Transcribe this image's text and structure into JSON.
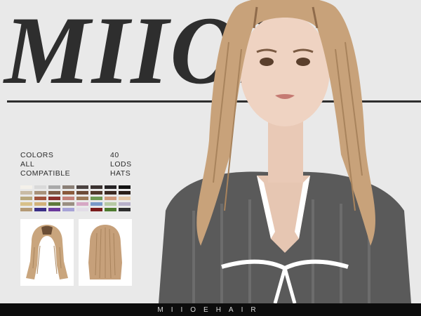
{
  "brand": {
    "title": "MIIOE"
  },
  "info": {
    "col1": [
      "COLORS",
      "ALL",
      "COMPATIBLE"
    ],
    "col2": [
      "40",
      "LODS",
      "HATS"
    ]
  },
  "swatches": [
    "#f4f1ea",
    "#d9d9d9",
    "#a9a9a9",
    "#8a7f76",
    "#4a4240",
    "#3a3230",
    "#252224",
    "#111111",
    "#c9bba5",
    "#a8927a",
    "#7e5d47",
    "#8a5a3c",
    "#6b4b38",
    "#51392c",
    "#3c2a22",
    "#2a1e18",
    "#b8a77d",
    "#a0533c",
    "#8a2f2a",
    "#c4827a",
    "#9c7a5a",
    "#6f9a55",
    "#cf9a7c",
    "#e6c9a7",
    "#d8c08a",
    "#d1b27a",
    "#5e7a3c",
    "#9a8f82",
    "#d6a7c4",
    "#7a9ac9",
    "#b6c9a4",
    "#b7b0c9",
    "#b49a76",
    "#3b2f86",
    "#6a3a9c",
    "#a6a2d6",
    "#e2dde7",
    "#7a1c1c",
    "#4e7a2f",
    "#2e2e2e"
  ],
  "previews": [
    {
      "view": "front"
    },
    {
      "view": "back"
    }
  ],
  "footer": {
    "label": "MIIOEHAIR"
  },
  "colors": {
    "text": "#2e2e2e",
    "footer_bg": "#0c0c0c",
    "hair": "#c8a27a"
  }
}
